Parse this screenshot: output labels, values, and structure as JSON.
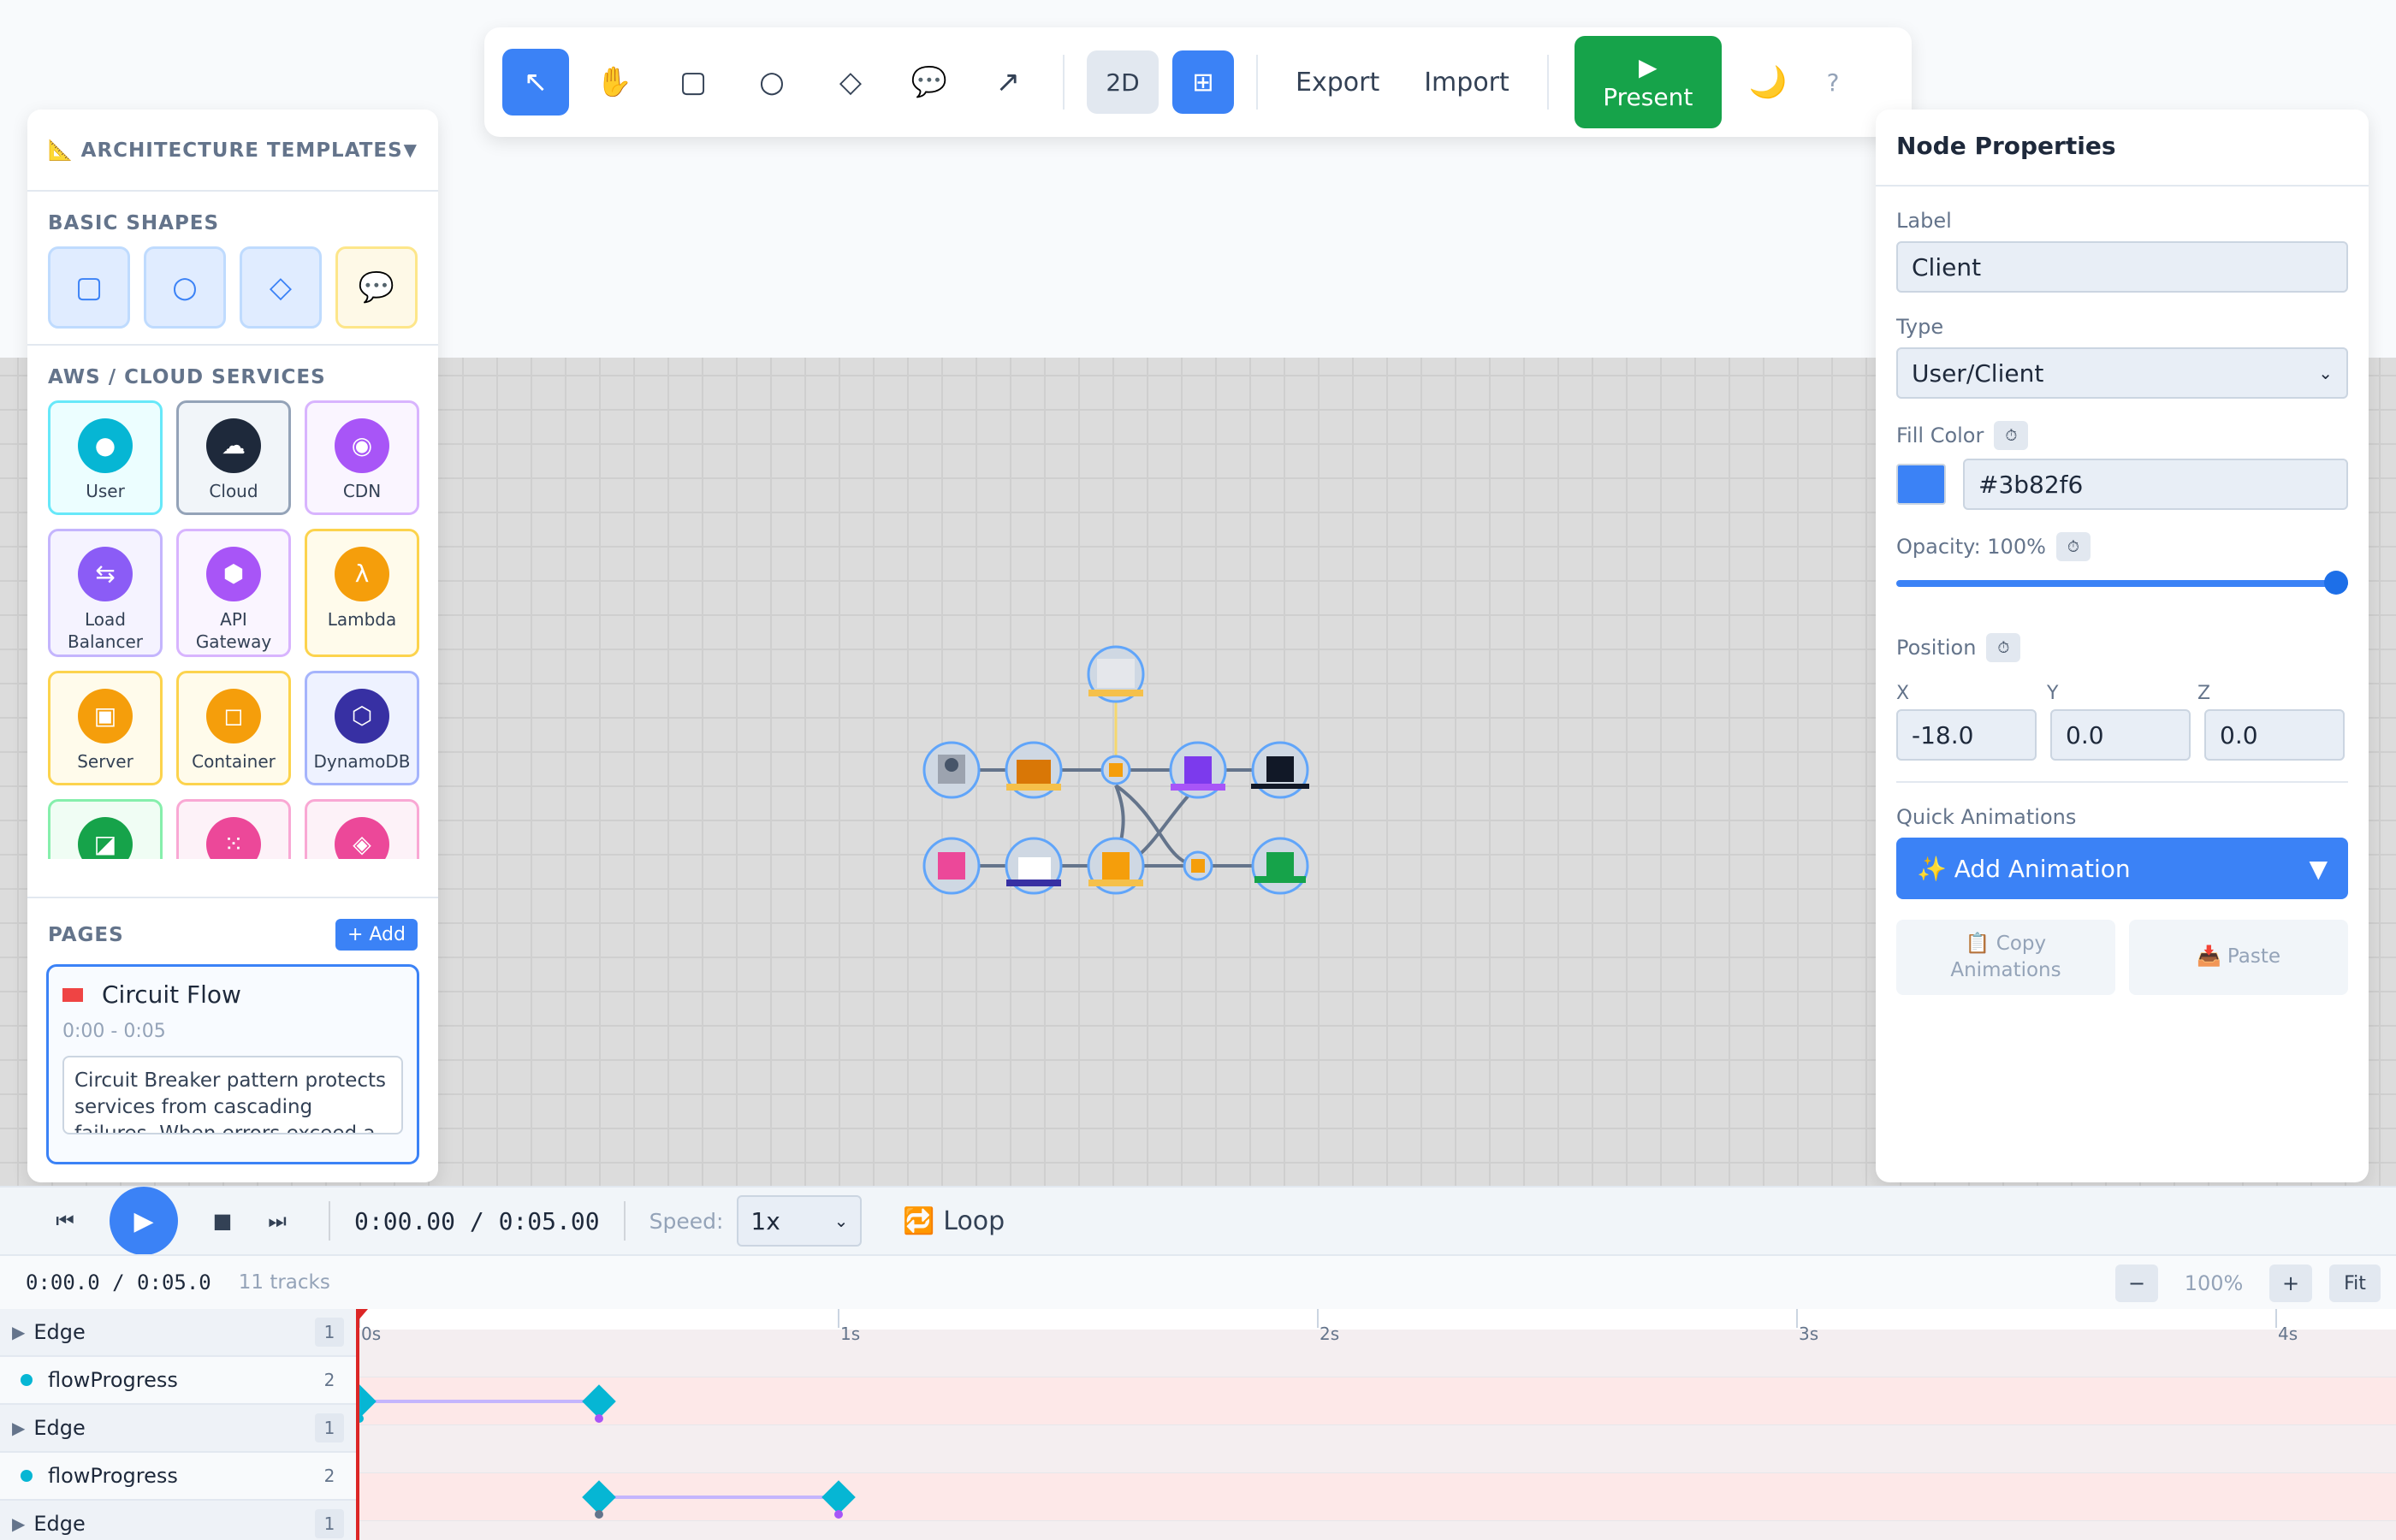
{
  "toolbar": {
    "tools": [
      {
        "name": "select-tool",
        "icon": "↖",
        "active": true
      },
      {
        "name": "pan-tool",
        "icon": "✋",
        "active": false
      },
      {
        "name": "rectangle-tool",
        "icon": "▢",
        "active": false
      },
      {
        "name": "circle-tool",
        "icon": "○",
        "active": false
      },
      {
        "name": "diamond-tool",
        "icon": "◇",
        "active": false
      },
      {
        "name": "note-tool",
        "icon": "💬",
        "active": false
      },
      {
        "name": "arrow-tool",
        "icon": "↗",
        "active": false
      }
    ],
    "mode_2d": "2D",
    "grid_icon": "⊞",
    "export_label": "Export",
    "import_label": "Import",
    "present_icon": "▶",
    "present_label": "Present",
    "moon_icon": "🌙",
    "help_label": "?"
  },
  "left_panel": {
    "templates_title": "📐 ARCHITECTURE TEMPLATES",
    "templates_chevron": "▼",
    "basic_shapes_title": "BASIC SHAPES",
    "basic_shapes": [
      {
        "name": "rectangle",
        "icon": "▢"
      },
      {
        "name": "circle",
        "icon": "○"
      },
      {
        "name": "diamond",
        "icon": "◇"
      },
      {
        "name": "note",
        "icon": "💬"
      }
    ],
    "services_title": "AWS / CLOUD SERVICES",
    "services": [
      {
        "label": "User",
        "icon": "●",
        "color": "#06b6d4",
        "bg": "#ecfeff",
        "border": "#67e8f9"
      },
      {
        "label": "Cloud",
        "icon": "☁",
        "color": "#1e293b",
        "bg": "#f1f5f9",
        "border": "#94a3b8"
      },
      {
        "label": "CDN",
        "icon": "◉",
        "color": "#a855f7",
        "bg": "#faf5ff",
        "border": "#d8b4fe"
      },
      {
        "label": "Load Balancer",
        "icon": "⇆",
        "color": "#8b5cf6",
        "bg": "#f5f3ff",
        "border": "#c4b5fd"
      },
      {
        "label": "API Gateway",
        "icon": "⬢",
        "color": "#a855f7",
        "bg": "#faf5ff",
        "border": "#d8b4fe"
      },
      {
        "label": "Lambda",
        "icon": "λ",
        "color": "#f59e0b",
        "bg": "#fffbeb",
        "border": "#fcd34d"
      },
      {
        "label": "Server",
        "icon": "▣",
        "color": "#f59e0b",
        "bg": "#fffbeb",
        "border": "#fcd34d"
      },
      {
        "label": "Container",
        "icon": "◻",
        "color": "#f59e0b",
        "bg": "#fffbeb",
        "border": "#fcd34d"
      },
      {
        "label": "DynamoDB",
        "icon": "⬡",
        "color": "#3730a3",
        "bg": "#eef2ff",
        "border": "#a5b4fc"
      },
      {
        "label": "",
        "icon": "◪",
        "color": "#16a34a",
        "bg": "#f0fdf4",
        "border": "#86efac"
      },
      {
        "label": "",
        "icon": "⁙",
        "color": "#ec4899",
        "bg": "#fdf2f8",
        "border": "#f9a8d4"
      },
      {
        "label": "",
        "icon": "◈",
        "color": "#ec4899",
        "bg": "#fdf2f8",
        "border": "#f9a8d4"
      }
    ],
    "pages_title": "PAGES",
    "add_page_label": "+ Add",
    "page": {
      "title": "Circuit Flow",
      "time": "0:00 - 0:05",
      "description": "Circuit Breaker pattern protects services from cascading failures. When errors exceed a threshold"
    }
  },
  "right_panel": {
    "title": "Node Properties",
    "label_label": "Label",
    "label_value": "Client",
    "type_label": "Type",
    "type_value": "User/Client",
    "fill_label": "Fill Color",
    "fill_value": "#3b82f6",
    "opacity_label": "Opacity: 100%",
    "opacity": 1.0,
    "position_label": "Position",
    "x_label": "X",
    "y_label": "Y",
    "z_label": "Z",
    "x_value": "-18.0",
    "y_value": "0.0",
    "z_value": "0.0",
    "quick_anim_label": "Quick Animations",
    "add_anim_label": "✨ Add Animation",
    "add_anim_chevron": "▼",
    "copy_label": "📋 Copy Animations",
    "paste_label": "📥 Paste",
    "clock_icon": "⏱"
  },
  "playback": {
    "skip_back_icon": "⏮",
    "play_icon": "▶",
    "stop_icon": "■",
    "skip_fwd_icon": "⏭",
    "time": "0:00.00 / 0:05.00",
    "speed_label": "Speed:",
    "speed_value": "1x",
    "loop_label": "🔁 Loop"
  },
  "timeline": {
    "time": "0:00.0 / 0:05.0",
    "tracks_label": "11 tracks",
    "zoom_out": "−",
    "zoom_level": "100%",
    "zoom_in": "+",
    "fit_label": "Fit",
    "ticks": [
      "0s",
      "1s",
      "2s",
      "3s",
      "4s"
    ],
    "rows": [
      {
        "type": "edge",
        "label": "Edge",
        "count": "1"
      },
      {
        "type": "sub",
        "label": "flowProgress",
        "count": "2"
      },
      {
        "type": "edge",
        "label": "Edge",
        "count": "1"
      },
      {
        "type": "sub",
        "label": "flowProgress",
        "count": "2"
      },
      {
        "type": "edge",
        "label": "Edge",
        "count": "1"
      }
    ],
    "keyframes": [
      {
        "row": 1,
        "start": 0.0,
        "end": 0.5
      },
      {
        "row": 3,
        "start": 0.5,
        "end": 1.0
      }
    ]
  },
  "colors": {
    "accent": "#3b82f6",
    "present": "#16a34a",
    "keyframe": "#06b6d4",
    "playhead": "#dc2626"
  }
}
